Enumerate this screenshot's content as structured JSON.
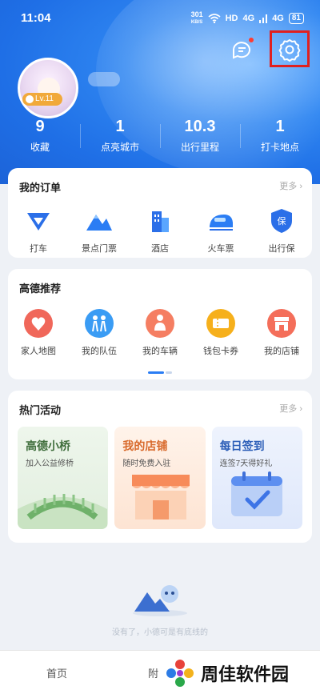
{
  "status": {
    "time": "11:04",
    "net_speed": "301",
    "net_unit": "KB/S",
    "hd": "HD",
    "sig1": "4G",
    "sig2": "4G",
    "battery": "81"
  },
  "user": {
    "level": "Lv.11"
  },
  "stats": [
    {
      "value": "9",
      "label": "收藏"
    },
    {
      "value": "1",
      "label": "点亮城市"
    },
    {
      "value": "10.3",
      "label": "出行里程"
    },
    {
      "value": "1",
      "label": "打卡地点"
    }
  ],
  "orders": {
    "title": "我的订单",
    "more": "更多",
    "items": [
      {
        "label": "打车",
        "icon": "taxi-icon"
      },
      {
        "label": "景点门票",
        "icon": "mountain-icon"
      },
      {
        "label": "酒店",
        "icon": "hotel-icon"
      },
      {
        "label": "火车票",
        "icon": "train-icon"
      },
      {
        "label": "出行保",
        "icon": "insurance-icon"
      }
    ]
  },
  "recommend": {
    "title": "高德推荐",
    "items": [
      {
        "label": "家人地图",
        "icon": "family-map-icon",
        "color": "#f0675a"
      },
      {
        "label": "我的队伍",
        "icon": "team-icon",
        "color": "#3a9cf4"
      },
      {
        "label": "我的车辆",
        "icon": "vehicle-icon",
        "color": "#f57e62"
      },
      {
        "label": "钱包卡券",
        "icon": "coupon-icon",
        "color": "#f6b01c"
      },
      {
        "label": "我的店铺",
        "icon": "shop-icon",
        "color": "#f46e5a"
      }
    ]
  },
  "activities": {
    "title": "热门活动",
    "more": "更多",
    "items": [
      {
        "title": "高德小桥",
        "subtitle": "加入公益修桥",
        "title_color": "#3f6e3c"
      },
      {
        "title": "我的店铺",
        "subtitle": "随时免费入驻",
        "title_color": "#d8692b"
      },
      {
        "title": "每日签到",
        "subtitle": "连签7天得好礼",
        "title_color": "#2d5fb8"
      }
    ]
  },
  "empty_text": "没有了，小德可是有底线的",
  "tabs": {
    "home": "首页",
    "nearby": "附"
  },
  "watermark": {
    "text": "周佳软件园"
  }
}
